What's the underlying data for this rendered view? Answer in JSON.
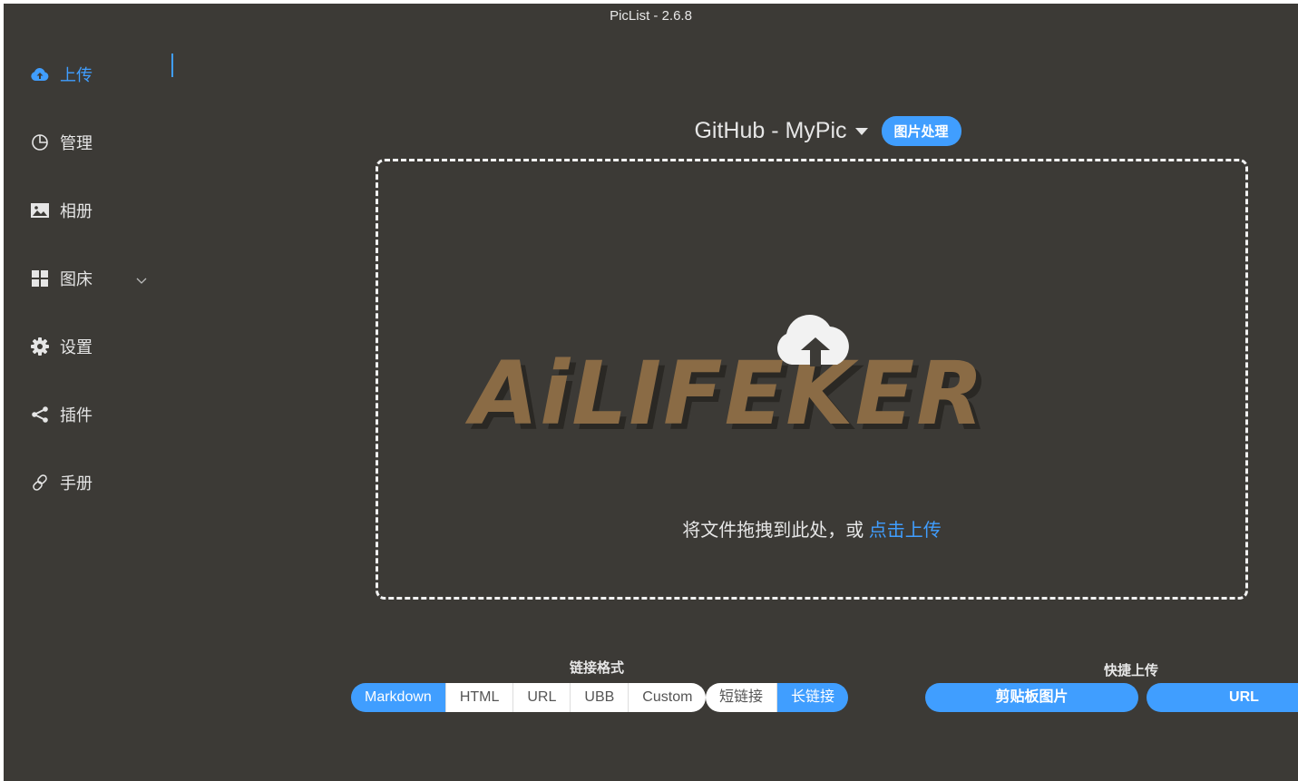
{
  "window": {
    "title": "PicList - 2.6.8"
  },
  "sidebar": {
    "items": [
      {
        "label": "上传",
        "icon": "cloud-upload-icon",
        "active": true
      },
      {
        "label": "管理",
        "icon": "pie-chart-icon"
      },
      {
        "label": "相册",
        "icon": "picture-icon"
      },
      {
        "label": "图床",
        "icon": "grid-icon",
        "expandable": true
      },
      {
        "label": "设置",
        "icon": "gear-icon"
      },
      {
        "label": "插件",
        "icon": "share-icon"
      },
      {
        "label": "手册",
        "icon": "link-icon"
      }
    ]
  },
  "upload": {
    "picbed_label": "GitHub - MyPic",
    "process_button": "图片处理",
    "watermark": "AiLIFEKER",
    "drop_text": "将文件拖拽到此处，或 ",
    "drop_link": "点击上传"
  },
  "link_format": {
    "label": "链接格式",
    "options": [
      "Markdown",
      "HTML",
      "URL",
      "UBB",
      "Custom"
    ],
    "selected": "Markdown",
    "length_options": [
      "短链接",
      "长链接"
    ],
    "length_selected": "长链接"
  },
  "quick_upload": {
    "label": "快捷上传",
    "buttons": [
      "剪贴板图片",
      "URL"
    ]
  },
  "colors": {
    "accent": "#409eff",
    "background": "#3c3a36",
    "text": "#e6e6e6"
  }
}
